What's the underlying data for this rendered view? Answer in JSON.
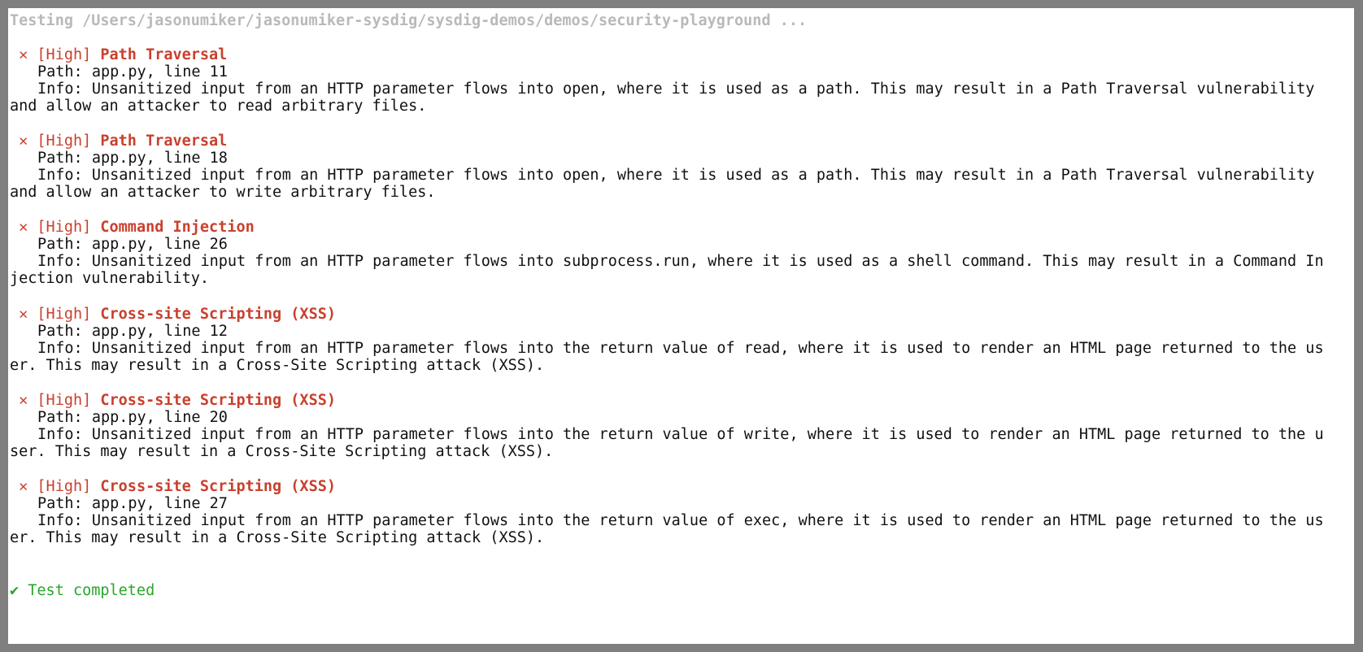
{
  "terminal": {
    "header": "Testing /Users/jasonumiker/jasonumiker-sysdig/sysdig-demos/demos/security-playground ...",
    "issues": [
      {
        "marker": "✕",
        "severity": "[High]",
        "title": "Path Traversal",
        "path": "Path: app.py, line 11",
        "info_line1": "Info: Unsanitized input from an HTTP parameter flows into open, where it is used as a path. This may result in a Path Traversal vulnerability",
        "info_line2": "and allow an attacker to read arbitrary files."
      },
      {
        "marker": "✕",
        "severity": "[High]",
        "title": "Path Traversal",
        "path": "Path: app.py, line 18",
        "info_line1": "Info: Unsanitized input from an HTTP parameter flows into open, where it is used as a path. This may result in a Path Traversal vulnerability",
        "info_line2": "and allow an attacker to write arbitrary files."
      },
      {
        "marker": "✕",
        "severity": "[High]",
        "title": "Command Injection",
        "path": "Path: app.py, line 26",
        "info_line1": "Info: Unsanitized input from an HTTP parameter flows into subprocess.run, where it is used as a shell command. This may result in a Command In",
        "info_line2": "jection vulnerability."
      },
      {
        "marker": "✕",
        "severity": "[High]",
        "title": "Cross-site Scripting (XSS)",
        "path": "Path: app.py, line 12",
        "info_line1": "Info: Unsanitized input from an HTTP parameter flows into the return value of read, where it is used to render an HTML page returned to the us",
        "info_line2": "er. This may result in a Cross-Site Scripting attack (XSS)."
      },
      {
        "marker": "✕",
        "severity": "[High]",
        "title": "Cross-site Scripting (XSS)",
        "path": "Path: app.py, line 20",
        "info_line1": "Info: Unsanitized input from an HTTP parameter flows into the return value of write, where it is used to render an HTML page returned to the u",
        "info_line2": "ser. This may result in a Cross-Site Scripting attack (XSS)."
      },
      {
        "marker": "✕",
        "severity": "[High]",
        "title": "Cross-site Scripting (XSS)",
        "path": "Path: app.py, line 27",
        "info_line1": "Info: Unsanitized input from an HTTP parameter flows into the return value of exec, where it is used to render an HTML page returned to the us",
        "info_line2": "er. This may result in a Cross-Site Scripting attack (XSS)."
      }
    ],
    "footer": "✔ Test completed"
  },
  "colors": {
    "severity": "#c9402d",
    "success": "#2aa52a",
    "muted": "#b9b9b9"
  }
}
